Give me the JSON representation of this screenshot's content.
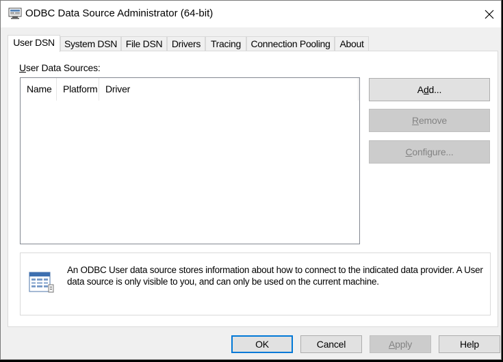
{
  "window": {
    "title": "ODBC Data Source Administrator (64-bit)",
    "icon": "odbc-admin-icon",
    "close_icon": "close-icon"
  },
  "tabs": [
    {
      "label": "User DSN",
      "active": true
    },
    {
      "label": "System DSN"
    },
    {
      "label": "File DSN"
    },
    {
      "label": "Drivers"
    },
    {
      "label": "Tracing"
    },
    {
      "label": "Connection Pooling"
    },
    {
      "label": "About"
    }
  ],
  "user_dsn": {
    "label_prefix": "U",
    "label_rest": "ser Data Sources:",
    "columns": [
      "Name",
      "Platform",
      "Driver"
    ],
    "rows": [],
    "buttons": {
      "add": {
        "pre": "A",
        "mn": "d",
        "post": "d...",
        "enabled": true
      },
      "remove": {
        "pre": "",
        "mn": "R",
        "post": "emove",
        "enabled": false
      },
      "configure": {
        "pre": "",
        "mn": "C",
        "post": "onfigure...",
        "enabled": false
      }
    },
    "info_text": "An ODBC User data source stores information about how to connect to the indicated data provider.   A User data source is only visible to you, and can only be used on the current machine.",
    "info_icon": "data-source-icon"
  },
  "dialog_buttons": {
    "ok": "OK",
    "cancel": "Cancel",
    "apply_mn": "A",
    "apply_rest": "pply",
    "help": "Help"
  },
  "colors": {
    "accent": "#0078d7",
    "background": "#f0f0f0",
    "disabled_text": "#838383"
  }
}
